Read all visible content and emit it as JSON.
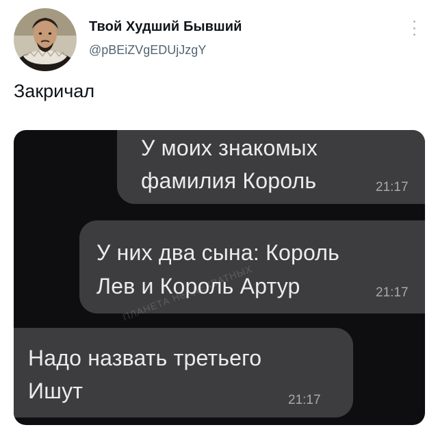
{
  "tweet": {
    "author": {
      "display_name": "Твой Худший Бывший",
      "handle": "@pBEiZVgEDUjJzgY",
      "avatar": "avatar-photo"
    },
    "text": "Закричал",
    "menu_icon": "more-vertical-icon"
  },
  "media": {
    "type": "chat-screenshot",
    "messages": [
      {
        "side": "right",
        "lines": [
          "У моих знакомых",
          "фамилия Король"
        ],
        "time": "21:17"
      },
      {
        "side": "right",
        "lines": [
          "У них два сына: Король",
          "Лев и Король Артур"
        ],
        "time": "21:17"
      },
      {
        "side": "left",
        "lines": [
          "Надо назвать третьего",
          "Ишут"
        ],
        "time": "21:17"
      }
    ],
    "watermark": "ПЛАНЕТА НеАДЕКВАТНЫХ"
  },
  "colors": {
    "chat_background": "#0e0e10",
    "bubble": "#3d3d40",
    "bubble_text": "#ececec",
    "handle": "#536471"
  }
}
